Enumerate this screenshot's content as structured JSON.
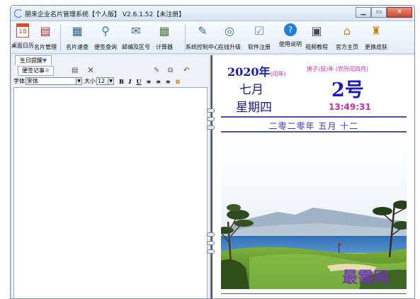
{
  "window": {
    "title": "朋来企业名片管理系统【个人版】 V2.6.1.52【未注册】",
    "controls": [
      "minimize",
      "maximize",
      "close"
    ]
  },
  "toolbar": {
    "items": [
      {
        "label": "桌面日历",
        "icon": "calendar-icon",
        "glyph": "18",
        "color": "#d84a2a"
      },
      {
        "label": "名片管理",
        "icon": "card-manager-icon",
        "glyph": "▤",
        "color": "#c62828"
      },
      {
        "label": "名片速查",
        "icon": "card-search-icon",
        "glyph": "▦",
        "color": "#2e5f9e"
      },
      {
        "label": "便签查询",
        "icon": "note-search-icon",
        "glyph": "⚲",
        "color": "#2a7fb8"
      },
      {
        "label": "邮编及区号",
        "icon": "postcode-icon",
        "glyph": "✉",
        "color": "#3b6ea8"
      },
      {
        "label": "计算器",
        "icon": "calculator-icon",
        "glyph": "▦",
        "color": "#4b7a3a"
      },
      {
        "label": "系统控制中心",
        "icon": "control-center-icon",
        "glyph": "✎",
        "color": "#3a66b0"
      },
      {
        "label": "在线升级",
        "icon": "online-upgrade-icon",
        "glyph": "◎",
        "color": "#3a7a9a"
      },
      {
        "label": "软件注册",
        "icon": "register-icon",
        "glyph": "☑",
        "color": "#7a8a9a"
      },
      {
        "label": "使用说明",
        "icon": "help-icon",
        "glyph": "?",
        "color": "#1f7fd8"
      },
      {
        "label": "视频教程",
        "icon": "video-tutorial-icon",
        "glyph": "▣",
        "color": "#4a4a4a"
      },
      {
        "label": "官方主页",
        "icon": "home-icon",
        "glyph": "⌂",
        "color": "#c8841a"
      },
      {
        "label": "更换皮肤",
        "icon": "skin-icon",
        "glyph": "♜",
        "color": "#c8841a"
      }
    ]
  },
  "left_panel": {
    "birthday_tab": "生日提醒",
    "notes_tab": "便签记事",
    "format": {
      "font_label": "字体",
      "font_value": "宋体",
      "size_label": "大小",
      "size_value": "12",
      "bold": "B",
      "italic": "I",
      "underline": "U"
    }
  },
  "calendar": {
    "year": "2020年",
    "leap_note": "(闰年)",
    "ganzhi": "庚子(鼠)年 (农历闰四月)",
    "month": "七月",
    "day": "2号",
    "weekday": "星期四",
    "time": "13:49:31",
    "lunar_date": "二零二零年  五月  十二"
  },
  "watermark": "最需网",
  "colors": {
    "accent_blue": "#1a1ab8",
    "accent_magenta": "#cc2bb0",
    "window_frame": "#dfe9f5"
  }
}
